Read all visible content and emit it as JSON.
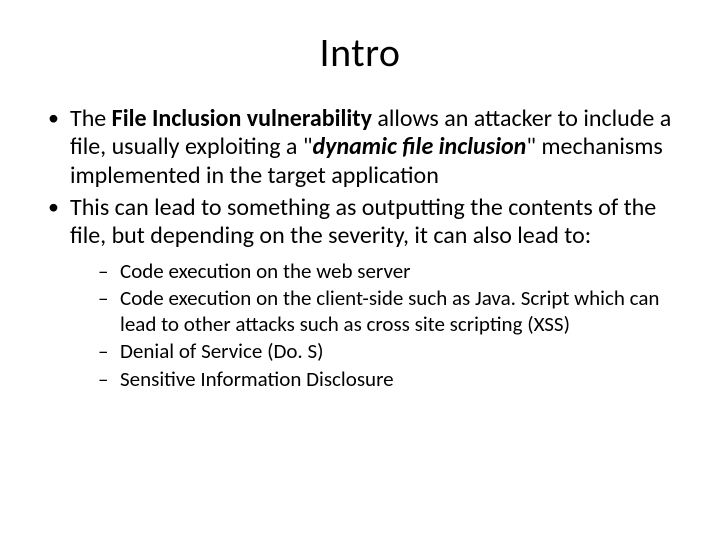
{
  "title": "Intro",
  "bullets": {
    "b1": {
      "pre": "The ",
      "strong": "File Inclusion vulnerability",
      "mid": " allows an attacker to include a file, usually exploiting a \"",
      "em": "dynamic file inclusion",
      "post": "\" mechanisms implemented in the target application"
    },
    "b2": "This can lead to something as outputting the contents of the file, but depending on the severity, it can also lead to:"
  },
  "sub": {
    "s1": "Code execution on the web server",
    "s2": "Code execution on the client-side such as Java. Script which can lead to other attacks such as cross site scripting (XSS)",
    "s3": "Denial of Service (Do. S)",
    "s4": "Sensitive Information Disclosure"
  }
}
